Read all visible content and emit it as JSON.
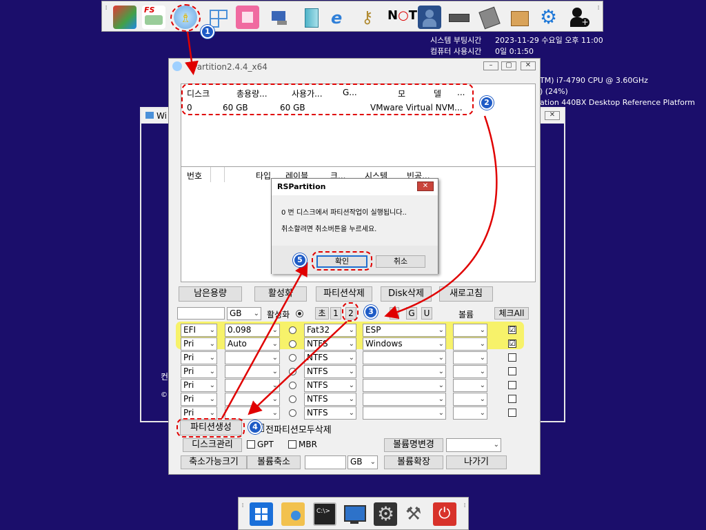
{
  "sysinfo": {
    "line1_label": "시스템 부팅시간",
    "line1_value": "2023-11-29 수요일 오후 11:00",
    "line2_label": "컴퓨터 사용시간",
    "line2_value": "0일 0:1:50",
    "cpu": "TM) i7-4790 CPU @ 3.60GHz",
    "mem": ") (24%)",
    "board": "ation 440BX Desktop Reference Platform"
  },
  "main_window": {
    "title": "Partition2.4.4_x64",
    "min": "–",
    "max": "▢",
    "close": "✕",
    "disk_headers": [
      "디스크",
      "총용량...",
      "사용가...",
      "G...",
      "모",
      "델",
      "..."
    ],
    "disk_row": [
      "0",
      "60 GB",
      "60 GB",
      "VMware Virtual NVM..."
    ],
    "part_headers": [
      "번호",
      "타입",
      "레이블",
      "크...",
      "시스템",
      "빈공..."
    ],
    "buttons": {
      "free": "남은용량",
      "activate": "활성화",
      "delete_part": "파티션삭제",
      "delete_disk": "Disk삭제",
      "refresh": "새로고침",
      "create": "파티션생성",
      "diskmgmt": "디스크관리",
      "shrink_size": "축소가능크기",
      "shrink": "볼륨축소",
      "rename_volume": "볼륨명변경",
      "extend": "볼륨확장",
      "exit": "나가기"
    },
    "size_unit": "GB",
    "col_active": "활성화",
    "tabs": [
      "초",
      "1",
      "2",
      "",
      "G",
      "U"
    ],
    "col_volume": "볼륨",
    "check_all": "체크All",
    "rows": [
      {
        "type": "EFI",
        "size": "0.098",
        "fs": "Fat32",
        "label": "ESP",
        "checked": "☑"
      },
      {
        "type": "Pri",
        "size": "Auto",
        "fs": "NTFS",
        "label": "Windows",
        "checked": "☑"
      },
      {
        "type": "Pri",
        "size": "",
        "fs": "NTFS",
        "label": "",
        "checked": ""
      },
      {
        "type": "Pri",
        "size": "",
        "fs": "NTFS",
        "label": "",
        "checked": ""
      },
      {
        "type": "Pri",
        "size": "",
        "fs": "NTFS",
        "label": "",
        "checked": ""
      },
      {
        "type": "Pri",
        "size": "",
        "fs": "NTFS",
        "label": "",
        "checked": ""
      },
      {
        "type": "Pri",
        "size": "",
        "fs": "NTFS",
        "label": "",
        "checked": ""
      }
    ],
    "delete_all_label": "전파티션모두삭제",
    "gpt_label": "GPT",
    "mbr_label": "MBR",
    "bottom_unit": "GB"
  },
  "back_window": {
    "title": "Wi",
    "side_text1": "컨",
    "side_text2": "©"
  },
  "dialog": {
    "title": "RSPartition",
    "line1": "0 번 디스크에서 파티션작업이 실행됩니다..",
    "line2": "취소할려면 취소버튼을 누르세요.",
    "ok": "확인",
    "cancel": "취소",
    "close": "✕"
  },
  "badges": [
    "1",
    "2",
    "3",
    "4",
    "5"
  ],
  "top_icons": [
    "partition-tool-icon",
    "fs-tool-icon",
    "rspartition-icon",
    "windows-tiles-icon",
    "office-icon",
    "network-icon",
    "book-icon",
    "ie-icon",
    "keys-icon",
    "notepad-icon",
    "user-photo-icon",
    "drive-icon",
    "floppy-icon",
    "box-icon",
    "gears-icon",
    "add-user-icon"
  ],
  "dock_icons": [
    "start-icon",
    "explorer-icon",
    "cmd-icon",
    "monitor-icon",
    "settings-icon",
    "tools-icon",
    "power-icon"
  ],
  "colors": {
    "desktop": "#1b0e6b",
    "accent_red": "#e00000",
    "badge_blue": "#1e5bc6",
    "highlight": "#f7f26a"
  }
}
